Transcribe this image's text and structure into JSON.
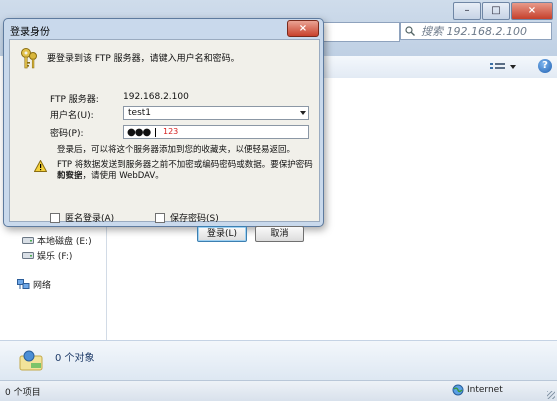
{
  "explorer": {
    "search_placeholder": "搜索 192.168.2.100",
    "nav": [
      {
        "label": "本地磁盘 (E:)",
        "icon": "drive-icon"
      },
      {
        "label": "娱乐 (F:)",
        "icon": "drive-icon"
      },
      {
        "label": "网络",
        "icon": "network-icon"
      }
    ],
    "details_text": "0 个对象",
    "status_left": "0 个项目",
    "status_zone": "Internet"
  },
  "dialog": {
    "title": "登录身份",
    "close_label": "×",
    "intro": "要登录到该 FTP 服务器，请键入用户名和密码。",
    "server_label": "FTP 服务器:",
    "server_value": "192.168.2.100",
    "username_label": "用户名(U):",
    "username_value": "test1",
    "password_label": "密码(P):",
    "password_dots": "●●●",
    "password_annotation": "123",
    "note1_line1": "登录后，可以将这个服务器添加到您的收藏夹，以便轻易返回。",
    "note2_line1": "FTP 将数据发送到服务器之前不加密或编码密码或数据。要保护密码和数据",
    "note2_line2": "的安全，请使用 WebDAV。",
    "anonymous_label": "匿名登录(A)",
    "save_password_label": "保存密码(S)",
    "login_label": "登录(L)",
    "cancel_label": "取消"
  },
  "colors": {
    "accent": "#3c7fb1",
    "annotation": "#d42020"
  }
}
